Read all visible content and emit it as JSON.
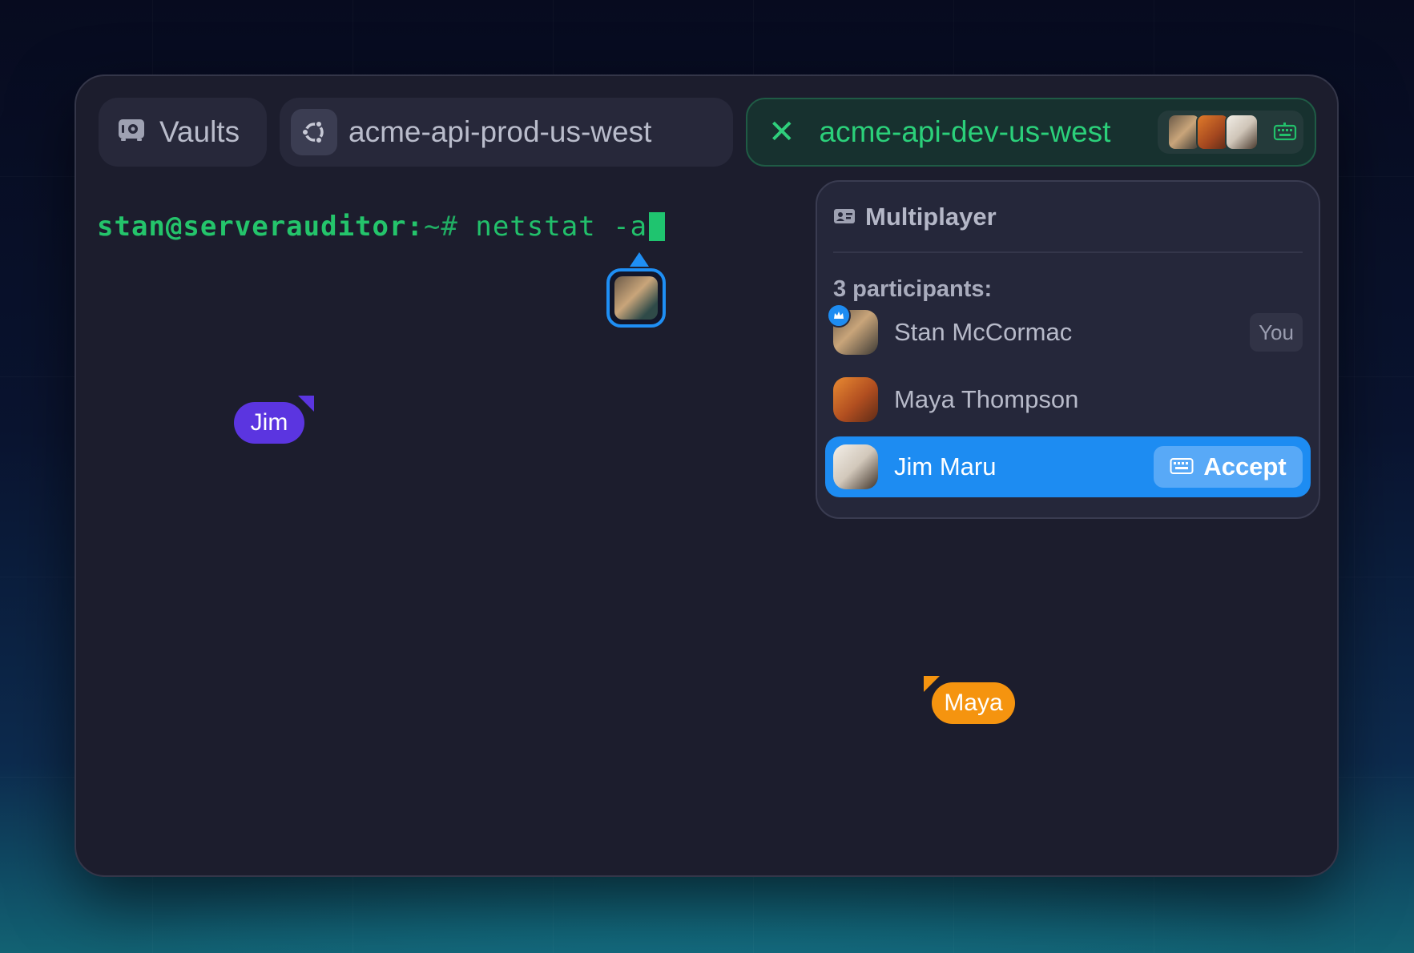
{
  "tabs": {
    "vaults": {
      "label": "Vaults",
      "icon": "vault-icon"
    },
    "prod": {
      "label": "acme-api-prod-us-west",
      "icon": "ubuntu-icon"
    },
    "dev": {
      "label": "acme-api-dev-us-west",
      "close_icon": "close-icon",
      "keyboard_icon": "keyboard-icon",
      "active": true
    }
  },
  "terminal": {
    "user_host": "stan@serverauditor:",
    "path_prompt": "~# ",
    "command": "netstat -a"
  },
  "cursors": {
    "jim": {
      "label": "Jim",
      "color": "#5b35e0"
    },
    "maya": {
      "label": "Maya",
      "color": "#f5940f"
    }
  },
  "multiplayer": {
    "title": "Multiplayer",
    "participants_label": "3 participants:",
    "participants": [
      {
        "name": "Stan McCormac",
        "badge": "You",
        "is_host": true
      },
      {
        "name": "Maya Thompson"
      },
      {
        "name": "Jim Maru",
        "action": "Accept",
        "highlighted": true
      }
    ]
  },
  "colors": {
    "accent_green": "#22c06b",
    "accent_blue": "#1d8cf2",
    "window_bg": "#1c1d2d"
  }
}
